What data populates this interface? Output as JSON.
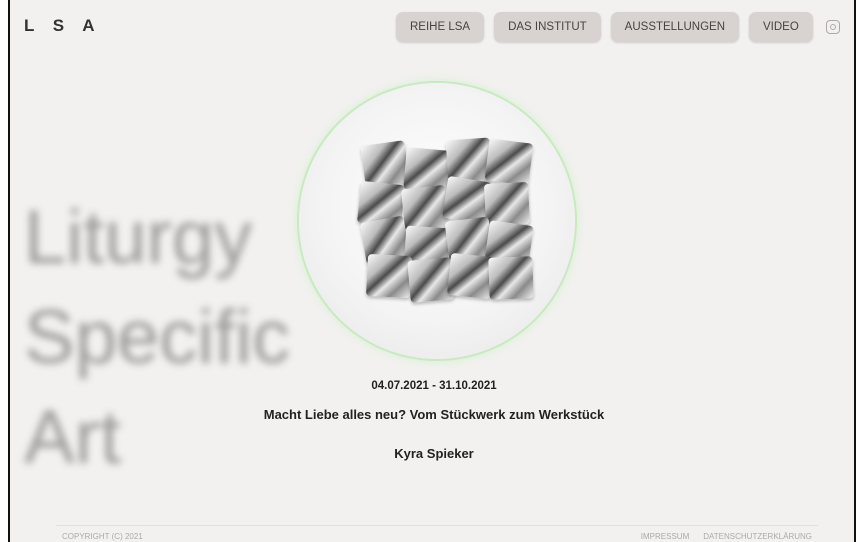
{
  "brand": {
    "logo": "L S A"
  },
  "nav": {
    "items": [
      "REIHE LSA",
      "DAS INSTITUT",
      "AUSSTELLUNGEN",
      "VIDEO"
    ],
    "instagram_icon": "instagram-icon"
  },
  "hero": {
    "background_title": [
      "Liturgy",
      "Specific",
      "Art"
    ],
    "image_icon": "cube-sculpture-image"
  },
  "exhibition": {
    "date": "04.07.2021 - 31.10.2021",
    "title": "Macht Liebe alles neu? Vom Stückwerk zum Werkstück",
    "artist": "Kyra Spieker"
  },
  "footer": {
    "copyright": "COPYRIGHT (C) 2021",
    "links": [
      "IMPRESSUM",
      "DATENSCHUTZERKLÄRUNG"
    ]
  },
  "colors": {
    "background": "#f2f1f0",
    "nav_button": "#d8d3d1",
    "circle_glow": "#c8eac0"
  }
}
